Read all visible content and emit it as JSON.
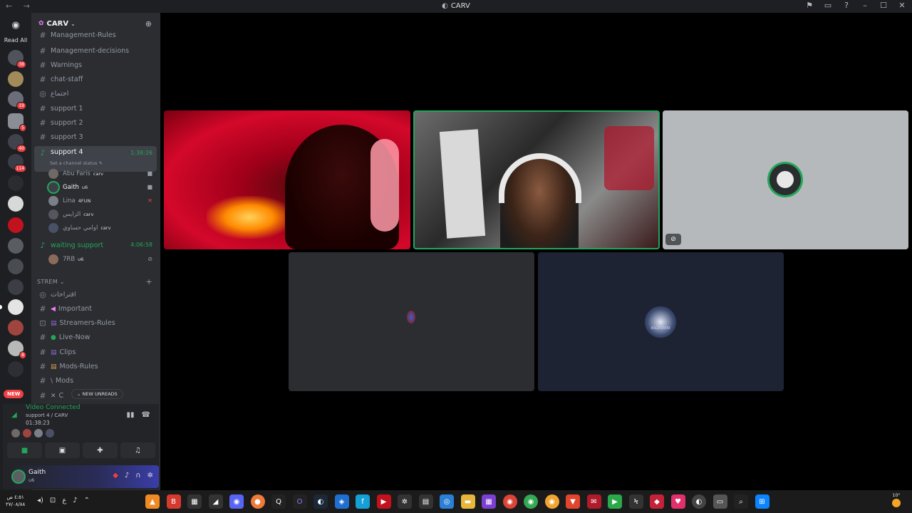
{
  "titlebar": {
    "nav": "← →",
    "title": "CARV",
    "icons": [
      "flag-icon",
      "inbox-icon",
      "help-icon",
      "minimize-icon",
      "maximize-icon",
      "close-icon"
    ],
    "glyphs": [
      "⚑",
      "▭",
      "?",
      "–",
      "☐",
      "✕"
    ]
  },
  "rail": {
    "read_all": "Read All",
    "new_label": "NEW",
    "badges": [
      "38",
      "19",
      "5",
      "40",
      "114",
      "8"
    ]
  },
  "server": {
    "name": "CARV"
  },
  "channels": {
    "management_rules": "Management-Rules",
    "management_decisions": "Management-decisions",
    "warnings": "Warnings",
    "chat_staff": "chat-staff",
    "meeting": "اجتماع",
    "support1": "support 1",
    "support2": "support 2",
    "support3": "support 3",
    "support4": "support 4",
    "support4_timer": "1:38:26",
    "support4_status": "Set a channel status ✎",
    "waiting_support": "waiting support",
    "waiting_timer": "4:06:58",
    "category_strem": "STREM",
    "suggestions": "اقتراحات",
    "important": "Important",
    "streamers_rules": "Streamers-Rules",
    "live_now": "Live-Now",
    "clips": "Clips",
    "mods_rules": "Mods-Rules",
    "mods": "Mods",
    "last": "C",
    "new_unreads": "NEW UNREADS"
  },
  "voice_users": [
    {
      "name": "Abu Faris",
      "tag": "carv"
    },
    {
      "name": "Gaith",
      "tag": "u6"
    },
    {
      "name": "Lina",
      "tag": "4FUN"
    },
    {
      "name": "الزايس",
      "tag": "carv"
    },
    {
      "name": "اوامي حساوي",
      "tag": "carv"
    }
  ],
  "waiting_users": [
    {
      "name": "7RB",
      "tag": "u6"
    }
  ],
  "voice_panel": {
    "status": "Video Connected",
    "location": "support 4 / CARV",
    "elapsed": "01:38:23"
  },
  "user_bar": {
    "name": "Gaith",
    "sub": "u6"
  },
  "stage": {
    "tile5_label": "ASGH2009"
  },
  "taskbar": {
    "time": "٤:٥١ ص",
    "date": "٢٧/٠٨/٨٨",
    "weather": "10°"
  },
  "colors": {
    "accent_green": "#23a55a",
    "badge_red": "#f23f43",
    "sidebar_bg": "#2b2d31",
    "rail_bg": "#1e1f22"
  }
}
